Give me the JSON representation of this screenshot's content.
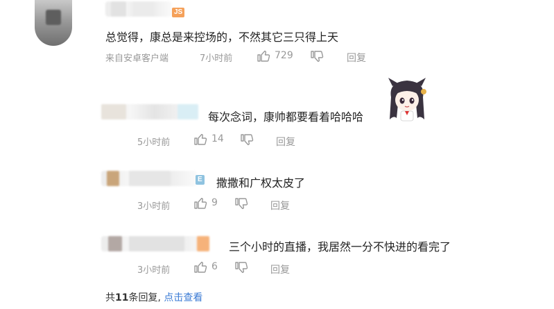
{
  "top_comment": {
    "text": "总觉得，康总是来控场的，不然其它三只得上天",
    "source": "来自安卓客户端",
    "time": "7小时前",
    "likes": "729",
    "reply_label": "回复",
    "badge": "JS"
  },
  "replies": [
    {
      "text": "每次念词，康帅都要看着哈哈哈",
      "time": "5小时前",
      "likes": "14",
      "reply_label": "回复"
    },
    {
      "text": "撒撒和广权太皮了",
      "time": "3小时前",
      "likes": "9",
      "reply_label": "回复",
      "badge": "E"
    },
    {
      "text": "三个小时的直播，我居然一分不快进的看完了",
      "time": "3小时前",
      "likes": "6",
      "reply_label": "回复"
    }
  ],
  "footer": {
    "prefix": "共",
    "count": "11",
    "suffix": "条回复,",
    "link": "点击查看"
  },
  "colors": {
    "meta": "#999999",
    "link": "#3b7bd5",
    "badge": "#f5a15a"
  },
  "icons": {
    "like": "thumbs-up-icon",
    "dislike": "thumbs-down-icon"
  }
}
